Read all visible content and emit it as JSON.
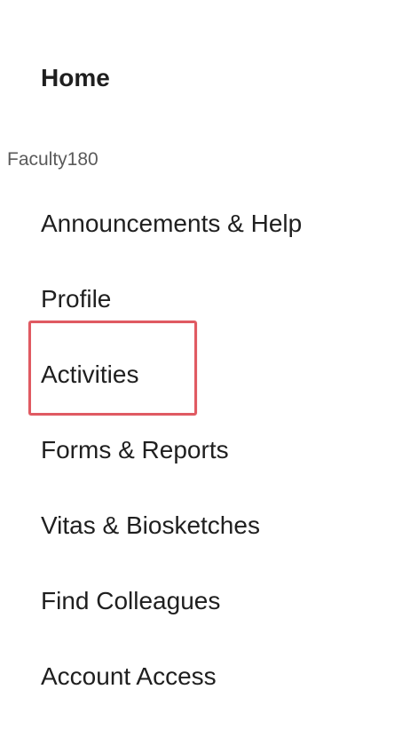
{
  "nav": {
    "home_label": "Home",
    "section_label": "Faculty180",
    "items": [
      {
        "label": "Announcements & Help"
      },
      {
        "label": "Profile"
      },
      {
        "label": "Activities"
      },
      {
        "label": "Forms & Reports"
      },
      {
        "label": "Vitas & Biosketches"
      },
      {
        "label": "Find Colleagues"
      },
      {
        "label": "Account Access"
      }
    ],
    "highlighted_item": "Activities"
  },
  "colors": {
    "text": "#1f1f1f",
    "section_label": "#5a5a5a",
    "highlight_border": "#e05a62",
    "background": "#ffffff"
  }
}
